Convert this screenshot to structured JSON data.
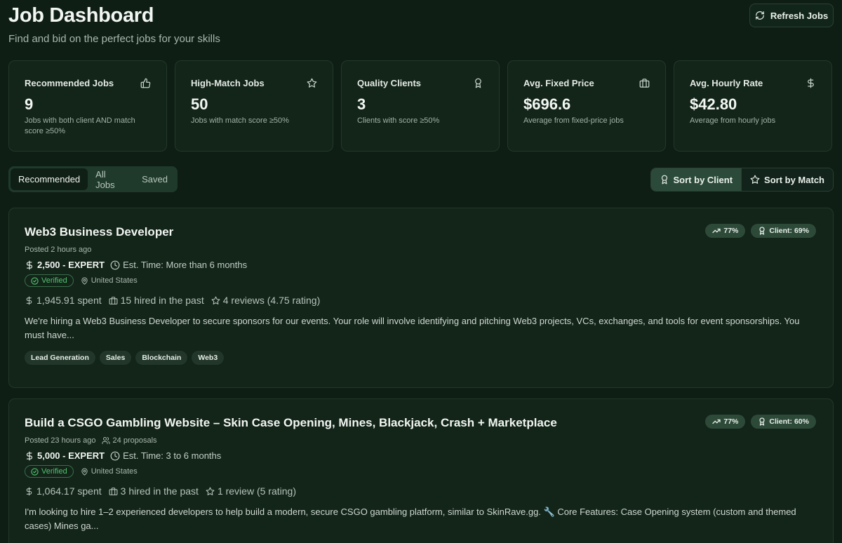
{
  "header": {
    "title": "Job Dashboard",
    "subtitle": "Find and bid on the perfect jobs for your skills",
    "refresh_label": "Refresh Jobs"
  },
  "stats": [
    {
      "label": "Recommended Jobs",
      "value": "9",
      "desc": "Jobs with both client AND match score ≥50%",
      "icon": "thumbs-up-icon"
    },
    {
      "label": "High-Match Jobs",
      "value": "50",
      "desc": "Jobs with match score ≥50%",
      "icon": "star-icon"
    },
    {
      "label": "Quality Clients",
      "value": "3",
      "desc": "Clients with score ≥50%",
      "icon": "award-icon"
    },
    {
      "label": "Avg. Fixed Price",
      "value": "$696.6",
      "desc": "Average from fixed-price jobs",
      "icon": "briefcase-icon"
    },
    {
      "label": "Avg. Hourly Rate",
      "value": "$42.80",
      "desc": "Average from hourly jobs",
      "icon": "dollar-icon"
    }
  ],
  "tabs": [
    {
      "label": "Recommended",
      "active": true
    },
    {
      "label": "All Jobs",
      "active": false
    },
    {
      "label": "Saved",
      "active": false
    }
  ],
  "sort": {
    "client_label": "Sort by Client",
    "match_label": "Sort by Match",
    "active": "client"
  },
  "jobs": [
    {
      "title": "Web3 Business Developer",
      "match": "77%",
      "client_score": "Client: 69%",
      "posted": "Posted 2 hours ago",
      "proposals": "",
      "price": "2,500 - EXPERT",
      "est_time": "Est. Time: More than 6 months",
      "verified": "Verified",
      "location": "United States",
      "spent": "1,945.91 spent",
      "hired": "15 hired in the past",
      "reviews": "4 reviews (4.75 rating)",
      "description": "We're hiring a Web3 Business Developer to secure sponsors for our events. Your role will involve identifying and pitching Web3 projects, VCs, exchanges, and tools for event sponsorships. You must have...",
      "tags": [
        "Lead Generation",
        "Sales",
        "Blockchain",
        "Web3"
      ]
    },
    {
      "title": "Build a CSGO Gambling Website – Skin Case Opening, Mines, Blackjack, Crash + Marketplace",
      "match": "77%",
      "client_score": "Client: 60%",
      "posted": "Posted 23 hours ago",
      "proposals": "24 proposals",
      "price": "5,000 - EXPERT",
      "est_time": "Est. Time: 3 to 6 months",
      "verified": "Verified",
      "location": "United States",
      "spent": "1,064.17 spent",
      "hired": "3 hired in the past",
      "reviews": "1 review (5 rating)",
      "description": "I'm looking to hire 1–2 experienced developers to help build a modern, secure CSGO gambling platform, similar to SkinRave.gg. 🔧 Core Features: Case Opening system (custom and themed cases) Mines ga...",
      "tags": []
    }
  ],
  "colors": {
    "background": "#0f1e15",
    "card": "#132419",
    "badge": "#2d4a39",
    "verified": "#4fc56e"
  }
}
